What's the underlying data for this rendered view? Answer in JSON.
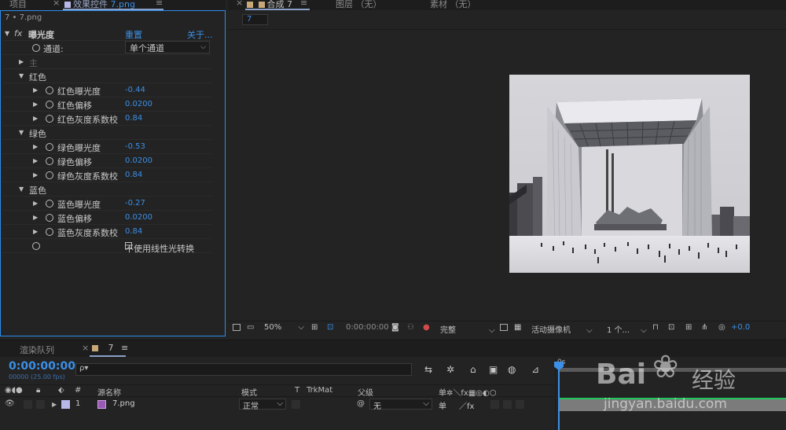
{
  "top_left_tabs": {
    "project": "项目",
    "close": "×",
    "effect_controls_prefix": "效果控件",
    "effect_controls_file": "7.png",
    "menu": "≡"
  },
  "top_right_tabs": {
    "close": "×",
    "comp": "合成 7",
    "comp_menu": "≡",
    "layer": "图层 （无）",
    "footage": "素材 （无）"
  },
  "fx_panel": {
    "file_label": "7 • 7.png",
    "effect_name": "曝光度",
    "fx_glyph": "fx",
    "reset": "重置",
    "about": "关于...",
    "channel_label": "通道:",
    "channel_value": "单个通道",
    "master_label": "主",
    "groups": [
      {
        "name": "红色",
        "props": [
          {
            "label": "红色曝光度",
            "value": "-0.44"
          },
          {
            "label": "红色偏移",
            "value": "0.0200"
          },
          {
            "label": "红色灰度系数校",
            "value": "0.84"
          }
        ]
      },
      {
        "name": "绿色",
        "props": [
          {
            "label": "绿色曝光度",
            "value": "-0.53"
          },
          {
            "label": "绿色偏移",
            "value": "0.0200"
          },
          {
            "label": "绿色灰度系数校",
            "value": "0.84"
          }
        ]
      },
      {
        "name": "蓝色",
        "props": [
          {
            "label": "蓝色曝光度",
            "value": "-0.27"
          },
          {
            "label": "蓝色偏移",
            "value": "0.0200"
          },
          {
            "label": "蓝色灰度系数校",
            "value": "0.84"
          }
        ]
      }
    ],
    "linear_checkbox_label": "不使用线性光转换"
  },
  "viewer": {
    "comp_tab": "7",
    "zoom": "50%",
    "timecode": "0:00:00:00",
    "resolution": "完整",
    "camera": "活动摄像机",
    "views": "1 个...",
    "exposure": "+0.0"
  },
  "timeline": {
    "render_queue_tab": "渲染队列",
    "close": "×",
    "comp_tab": "7",
    "menu": "≡",
    "timecode": "0:00:00:00",
    "fps": "00000 (25.00 fps)",
    "search_placeholder": "ρ▾",
    "columns": {
      "num": "#",
      "source_name": "源名称",
      "mode": "模式",
      "t": "T",
      "trkmat": "TrkMat",
      "parent": "父级",
      "switches": "单✲＼fx▦◎◐⬡"
    },
    "ruler_start": "0s",
    "layer": {
      "index": "1",
      "name": "7.png",
      "mode": "正常",
      "parent": "无",
      "switch_shy": "单",
      "switch_fx": "／fx"
    }
  },
  "watermark": {
    "brand": "Bai",
    "brand_cn": "经验",
    "url": "jingyan.baidu.com"
  },
  "colors": {
    "accent_blue": "#3b8fe6",
    "panel_border": "#2d8ceb",
    "bg": "#232323",
    "layer_label": "#b8b8e8",
    "source_icon": "#9b59b6",
    "green_bar": "#21c55d"
  }
}
